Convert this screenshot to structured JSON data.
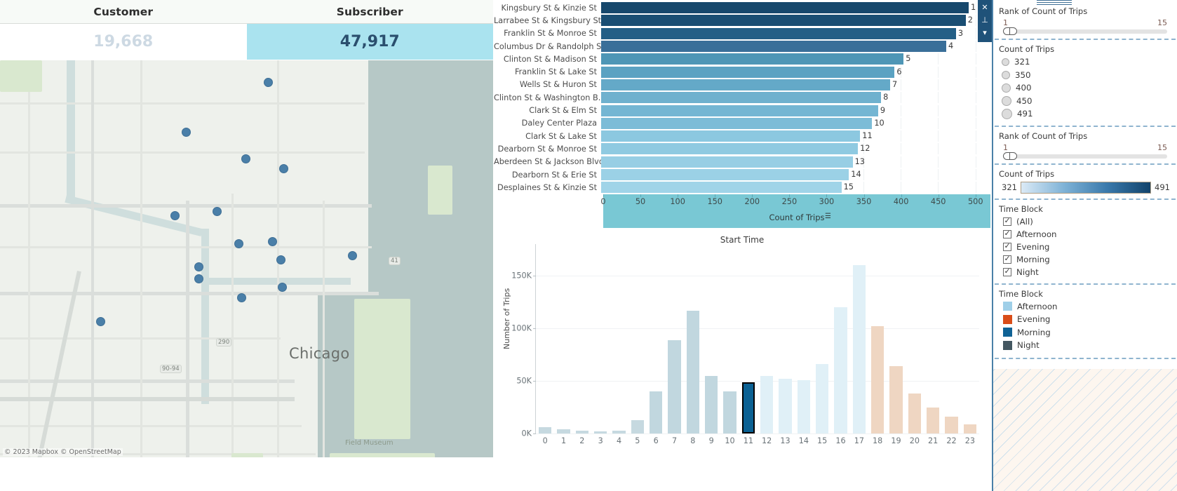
{
  "kpi": {
    "columns": [
      {
        "header": "Customer",
        "value": "19,668",
        "selected": false
      },
      {
        "header": "Subscriber",
        "value": "47,917",
        "selected": true
      }
    ]
  },
  "map": {
    "city_label": "Chicago",
    "poi_label": "Field Museum",
    "attribution": "© 2023 Mapbox © OpenStreetMap",
    "shields": [
      "41",
      "290",
      "90-94"
    ]
  },
  "toolbar": {
    "items": [
      {
        "name": "close-icon",
        "glyph": "✕"
      },
      {
        "name": "pin-icon",
        "glyph": "⊥"
      },
      {
        "name": "chevron-down-icon",
        "glyph": "▾"
      }
    ]
  },
  "sidebar": {
    "rank_filter_top": {
      "title": "Rank of Count of Trips",
      "min": "1",
      "max": "15"
    },
    "size_legend": {
      "title": "Count of Trips",
      "items": [
        {
          "label": "321",
          "size": 11
        },
        {
          "label": "350",
          "size": 12
        },
        {
          "label": "400",
          "size": 13
        },
        {
          "label": "450",
          "size": 14
        },
        {
          "label": "491",
          "size": 15
        }
      ]
    },
    "rank_filter_bottom": {
      "title": "Rank of Count of Trips",
      "min": "1",
      "max": "15"
    },
    "color_legend": {
      "title": "Count of Trips",
      "min": "321",
      "max": "491"
    },
    "time_block_filter": {
      "title": "Time Block",
      "options": [
        "(All)",
        "Afternoon",
        "Evening",
        "Morning",
        "Night"
      ]
    },
    "time_block_legend": {
      "title": "Time Block",
      "items": [
        {
          "label": "Afternoon",
          "color": "#9fcfe8"
        },
        {
          "label": "Evening",
          "color": "#d94d19"
        },
        {
          "label": "Morning",
          "color": "#0f6295"
        },
        {
          "label": "Night",
          "color": "#445761"
        }
      ]
    }
  },
  "chart_data": [
    {
      "type": "bar",
      "title": "",
      "xlabel": "Count of Trips",
      "ylabel": "",
      "orientation": "horizontal",
      "xlim": [
        0,
        520
      ],
      "xticks": [
        0,
        50,
        100,
        150,
        200,
        250,
        300,
        350,
        400,
        450,
        500
      ],
      "grid": true,
      "categories": [
        "Kingsbury St & Kinzie St",
        "Larrabee St & Kingsbury St",
        "Franklin St & Monroe St",
        "Columbus Dr & Randolph St",
        "Clinton St & Madison St",
        "Franklin St & Lake St",
        "Wells St & Huron St",
        "Clinton St & Washington B..",
        "Clark St & Elm St",
        "Daley Center Plaza",
        "Clark St & Lake St",
        "Dearborn St & Monroe St",
        "Aberdeen St & Jackson Blvd",
        "Dearborn St & Erie St",
        "Desplaines St & Kinzie St"
      ],
      "values": [
        491,
        487,
        474,
        461,
        404,
        392,
        386,
        374,
        370,
        362,
        346,
        343,
        336,
        331,
        321
      ],
      "rank_labels": [
        "1",
        "2",
        "3",
        "4",
        "5",
        "6",
        "7",
        "8",
        "9",
        "10",
        "11",
        "12",
        "13",
        "14",
        "15"
      ],
      "colors": [
        "#17486c",
        "#1a4e73",
        "#245f86",
        "#3a6f99",
        "#4e96b6",
        "#5ba2c2",
        "#64a9c8",
        "#6fb1ce",
        "#74b6d3",
        "#7cbcd7",
        "#8cc8e0",
        "#8fcae1",
        "#97cee4",
        "#9bd1e6",
        "#a0d4e8"
      ]
    },
    {
      "type": "bar",
      "title": "Start Time",
      "xlabel": "",
      "ylabel": "Number of Trips",
      "orientation": "vertical",
      "ylim": [
        0,
        175000
      ],
      "yticks": [
        0,
        50000,
        100000,
        150000
      ],
      "ytick_labels": [
        "0K",
        "50K",
        "100K",
        "150K"
      ],
      "grid": true,
      "categories": [
        "0",
        "1",
        "2",
        "3",
        "4",
        "5",
        "6",
        "7",
        "8",
        "9",
        "10",
        "11",
        "12",
        "13",
        "14",
        "15",
        "16",
        "17",
        "18",
        "19",
        "20",
        "21",
        "22",
        "23"
      ],
      "values": [
        6000,
        4000,
        2500,
        2000,
        2500,
        13000,
        40000,
        89000,
        117000,
        55000,
        40000,
        49000,
        55000,
        52000,
        51000,
        66000,
        120000,
        160000,
        102000,
        64000,
        38000,
        25000,
        16000,
        9000
      ],
      "colors": [
        "#c6d9e0",
        "#c6d9e0",
        "#c6d9e0",
        "#c6d9e0",
        "#c6d9e0",
        "#c6d9e0",
        "#c1d7df",
        "#c1d7df",
        "#c1d7df",
        "#c1d7df",
        "#c1d7df",
        "#0b6193",
        "#e0f0f7",
        "#e0f0f7",
        "#e0f0f7",
        "#e0f0f7",
        "#e0f0f7",
        "#e0f0f7",
        "#efd6c2",
        "#efd6c2",
        "#efd6c2",
        "#efd6c2",
        "#efd6c2",
        "#efd6c2"
      ],
      "selected_index": 11
    }
  ]
}
